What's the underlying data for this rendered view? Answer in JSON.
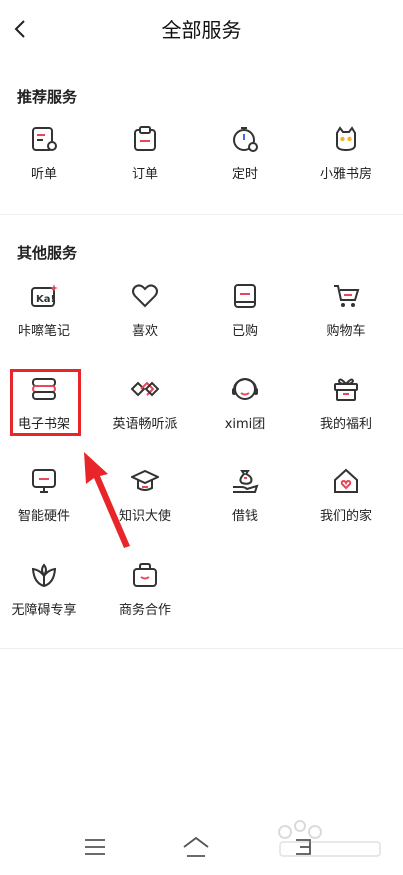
{
  "header": {
    "title": "全部服务"
  },
  "sections": [
    {
      "title": "推荐服务",
      "items": [
        {
          "label": "听单",
          "icon": "playlist-icon"
        },
        {
          "label": "订单",
          "icon": "order-icon"
        },
        {
          "label": "定时",
          "icon": "timer-icon"
        },
        {
          "label": "小雅书房",
          "icon": "xiaoya-owl-icon"
        }
      ]
    },
    {
      "title": "其他服务",
      "items": [
        {
          "label": "咔嚓笔记",
          "icon": "kaca-notes-icon"
        },
        {
          "label": "喜欢",
          "icon": "heart-icon"
        },
        {
          "label": "已购",
          "icon": "purchased-icon"
        },
        {
          "label": "购物车",
          "icon": "cart-icon"
        },
        {
          "label": "电子书架",
          "icon": "bookshelf-icon"
        },
        {
          "label": "英语畅听派",
          "icon": "english-listen-icon"
        },
        {
          "label": "ximi团",
          "icon": "ximi-group-icon"
        },
        {
          "label": "我的福利",
          "icon": "gift-icon"
        },
        {
          "label": "智能硬件",
          "icon": "smart-device-icon"
        },
        {
          "label": "知识大使",
          "icon": "graduation-cap-icon"
        },
        {
          "label": "借钱",
          "icon": "loan-hand-icon"
        },
        {
          "label": "我们的家",
          "icon": "home-heart-icon"
        },
        {
          "label": "无障碍专享",
          "icon": "accessibility-leaf-icon"
        },
        {
          "label": "商务合作",
          "icon": "business-bag-icon"
        }
      ]
    }
  ],
  "highlight": {
    "color": "#e8262a"
  },
  "accent": "#e8475a",
  "nav": [
    "menu-icon",
    "home-icon",
    "back-icon"
  ]
}
